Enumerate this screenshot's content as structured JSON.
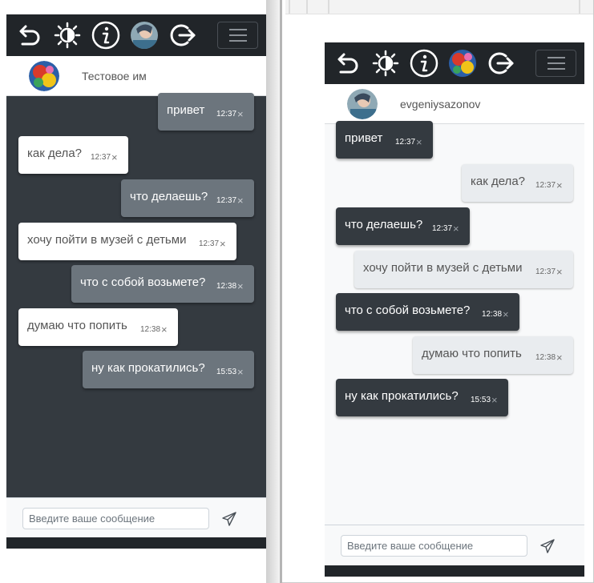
{
  "left": {
    "chat_name": "Тестовое им",
    "messages": [
      {
        "text": "привет",
        "time": "12:37",
        "del": "×"
      },
      {
        "text": "как дела?",
        "time": "12:37",
        "del": "×"
      },
      {
        "text": "что делаешь?",
        "time": "12:37",
        "del": "×"
      },
      {
        "text": "хочу пойти в музей с детьми",
        "time": "12:37",
        "del": "×"
      },
      {
        "text": "что с собой возьмете?",
        "time": "12:38",
        "del": "×"
      },
      {
        "text": "думаю что попить",
        "time": "12:38",
        "del": "×"
      },
      {
        "text": "ну как прокатились?",
        "time": "15:53",
        "del": "×"
      }
    ],
    "composer_placeholder": "Введите ваше сообщение"
  },
  "right": {
    "chat_name": "evgeniysazonov",
    "messages": [
      {
        "text": "привет",
        "time": "12:37",
        "del": "×"
      },
      {
        "text": "как дела?",
        "time": "12:37",
        "del": "×"
      },
      {
        "text": "что делаешь?",
        "time": "12:37",
        "del": "×"
      },
      {
        "text": "хочу пойти в музей с детьми",
        "time": "12:37",
        "del": "×"
      },
      {
        "text": "что с собой возьмете?",
        "time": "12:38",
        "del": "×"
      },
      {
        "text": "думаю что попить",
        "time": "12:38",
        "del": "×"
      },
      {
        "text": "ну как прокатились?",
        "time": "15:53",
        "del": "×"
      }
    ],
    "composer_placeholder": "Введите ваше сообщение"
  },
  "navbar_icons": [
    "undo-icon",
    "theme-toggle-icon",
    "info-icon",
    "user-avatar",
    "logout-icon",
    "menu-icon"
  ],
  "colors": {
    "navbar": "#212529",
    "dark_chat_bg": "#343a40",
    "light_chat_bg": "#f8f9fa",
    "bubble_gray": "#6c757d",
    "bubble_light": "#e9ecef"
  }
}
